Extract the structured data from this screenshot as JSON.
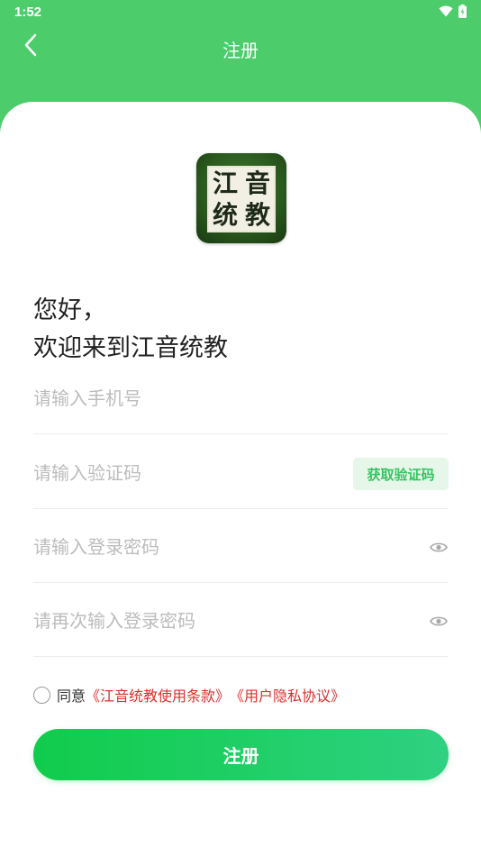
{
  "status_bar": {
    "time": "1:52",
    "icons": [
      "wifi-icon",
      "battery-icon"
    ]
  },
  "header": {
    "title": "注册",
    "back_icon": "chevron-left-icon"
  },
  "logo": {
    "chars": [
      "江",
      "音",
      "统",
      "教"
    ]
  },
  "greeting": {
    "line1": "您好，",
    "line2": "欢迎来到江音统教"
  },
  "form": {
    "phone_placeholder": "请输入手机号",
    "code_placeholder": "请输入验证码",
    "get_code_label": "获取验证码",
    "password_placeholder": "请输入登录密码",
    "confirm_password_placeholder": "请再次输入登录密码"
  },
  "agreement": {
    "prefix": "同意",
    "terms": "《江音统教使用条款》",
    "privacy": "《用户隐私协议》"
  },
  "register_label": "注册",
  "colors": {
    "header": "#4ccc6b",
    "accent": "#10cc4b",
    "link": "#e02e2e",
    "code_button_bg": "#e6f7ea"
  }
}
